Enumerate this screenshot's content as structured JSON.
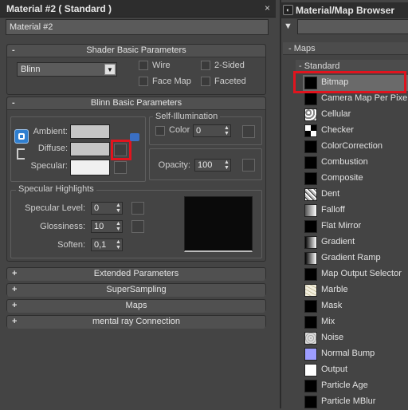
{
  "material_editor": {
    "title": "Material #2  ( Standard )",
    "close_glyph": "×",
    "material_name": "Material #2",
    "shader_basic": {
      "header": "Shader Basic Parameters",
      "sign": "-",
      "shader": "Blinn",
      "wire": "Wire",
      "two_sided": "2-Sided",
      "face_map": "Face Map",
      "faceted": "Faceted"
    },
    "blinn_basic": {
      "header": "Blinn Basic Parameters",
      "sign": "-",
      "ambient": "Ambient:",
      "diffuse": "Diffuse:",
      "specular": "Specular:",
      "self_illum_title": "Self-Illumination",
      "color_label": "Color",
      "self_illum_value": "0",
      "opacity_label": "Opacity:",
      "opacity_value": "100",
      "spec_highlights_title": "Specular Highlights",
      "spec_level_label": "Specular Level:",
      "spec_level_value": "0",
      "glossiness_label": "Glossiness:",
      "glossiness_value": "10",
      "soften_label": "Soften:",
      "soften_value": "0,1"
    },
    "collapsed_rollouts": [
      {
        "sign": "+",
        "label": "Extended Parameters"
      },
      {
        "sign": "+",
        "label": "SuperSampling"
      },
      {
        "sign": "+",
        "label": "Maps"
      },
      {
        "sign": "+",
        "label": "mental ray Connection"
      }
    ],
    "colors": {
      "ambient": "#c6c6c6",
      "diffuse": "#c6c6c6",
      "specular": "#f0f0f0",
      "highlight_box": "#e0141e"
    }
  },
  "map_browser": {
    "title": "Material/Map Browser",
    "app_icon": "max-icon",
    "filter_icon": "filter-icon",
    "search_value": "",
    "group_label": "Maps",
    "group_sign": "-",
    "category_label": "Standard",
    "category_sign": "-",
    "selected_item": "Bitmap",
    "items": [
      {
        "name": "Bitmap",
        "icon": "black"
      },
      {
        "name": "Camera Map Per Pixel",
        "icon": "black"
      },
      {
        "name": "Cellular",
        "icon": "cellular"
      },
      {
        "name": "Checker",
        "icon": "checker"
      },
      {
        "name": "ColorCorrection",
        "icon": "black"
      },
      {
        "name": "Combustion",
        "icon": "black"
      },
      {
        "name": "Composite",
        "icon": "black"
      },
      {
        "name": "Dent",
        "icon": "dent"
      },
      {
        "name": "Falloff",
        "icon": "falloff"
      },
      {
        "name": "Flat Mirror",
        "icon": "black"
      },
      {
        "name": "Gradient",
        "icon": "gradient"
      },
      {
        "name": "Gradient Ramp",
        "icon": "gradient"
      },
      {
        "name": "Map Output Selector",
        "icon": "black"
      },
      {
        "name": "Marble",
        "icon": "marble"
      },
      {
        "name": "Mask",
        "icon": "black"
      },
      {
        "name": "Mix",
        "icon": "black"
      },
      {
        "name": "Noise",
        "icon": "noise"
      },
      {
        "name": "Normal Bump",
        "icon": "normal"
      },
      {
        "name": "Output",
        "icon": "white"
      },
      {
        "name": "Particle Age",
        "icon": "black"
      },
      {
        "name": "Particle MBlur",
        "icon": "black"
      }
    ]
  }
}
